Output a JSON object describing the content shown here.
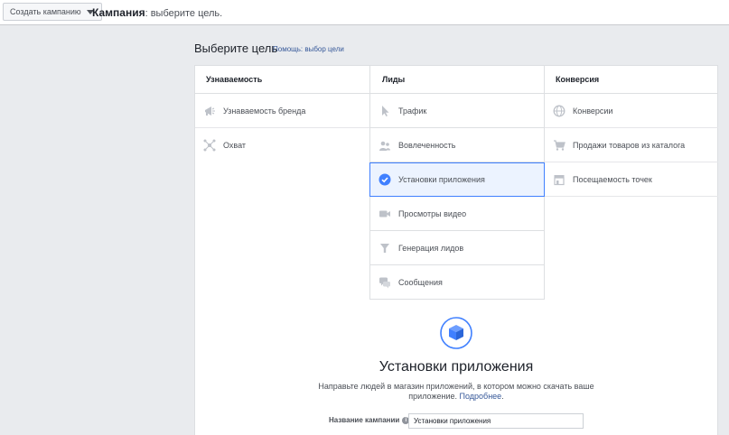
{
  "topbar": {
    "create_label": "Создать кампанию",
    "breadcrumb_bold": "Кампания",
    "breadcrumb_rest": ": выберите цель."
  },
  "objective": {
    "heading": "Выберите цель",
    "help_link": "Помощь: выбор цели"
  },
  "columns": [
    {
      "title": "Узнаваемость",
      "items": [
        {
          "label": "Узнаваемость бренда",
          "icon": "megaphone-icon"
        },
        {
          "label": "Охват",
          "icon": "reach-icon"
        }
      ]
    },
    {
      "title": "Лиды",
      "items": [
        {
          "label": "Трафик",
          "icon": "cursor-icon"
        },
        {
          "label": "Вовлеченность",
          "icon": "people-icon"
        },
        {
          "label": "Установки приложения",
          "icon": "check-circle-icon",
          "selected": true
        },
        {
          "label": "Просмотры видео",
          "icon": "video-camera-icon"
        },
        {
          "label": "Генерация лидов",
          "icon": "funnel-icon"
        },
        {
          "label": "Сообщения",
          "icon": "chat-bubbles-icon"
        }
      ]
    },
    {
      "title": "Конверсия",
      "items": [
        {
          "label": "Конверсии",
          "icon": "globe-icon"
        },
        {
          "label": "Продажи товаров из каталога",
          "icon": "cart-icon"
        },
        {
          "label": "Посещаемость точек",
          "icon": "store-icon"
        }
      ]
    }
  ],
  "detail": {
    "icon": "app-box-icon",
    "title": "Установки приложения",
    "description": "Направьте людей в магазин приложений, в котором можно скачать ваше приложение.",
    "more_link": "Подробнее",
    "field_label": "Название кампании",
    "field_value": "Установки приложения"
  },
  "colors": {
    "accent": "#4080ff",
    "selected_bg": "#ecf3ff",
    "link": "#365899"
  }
}
